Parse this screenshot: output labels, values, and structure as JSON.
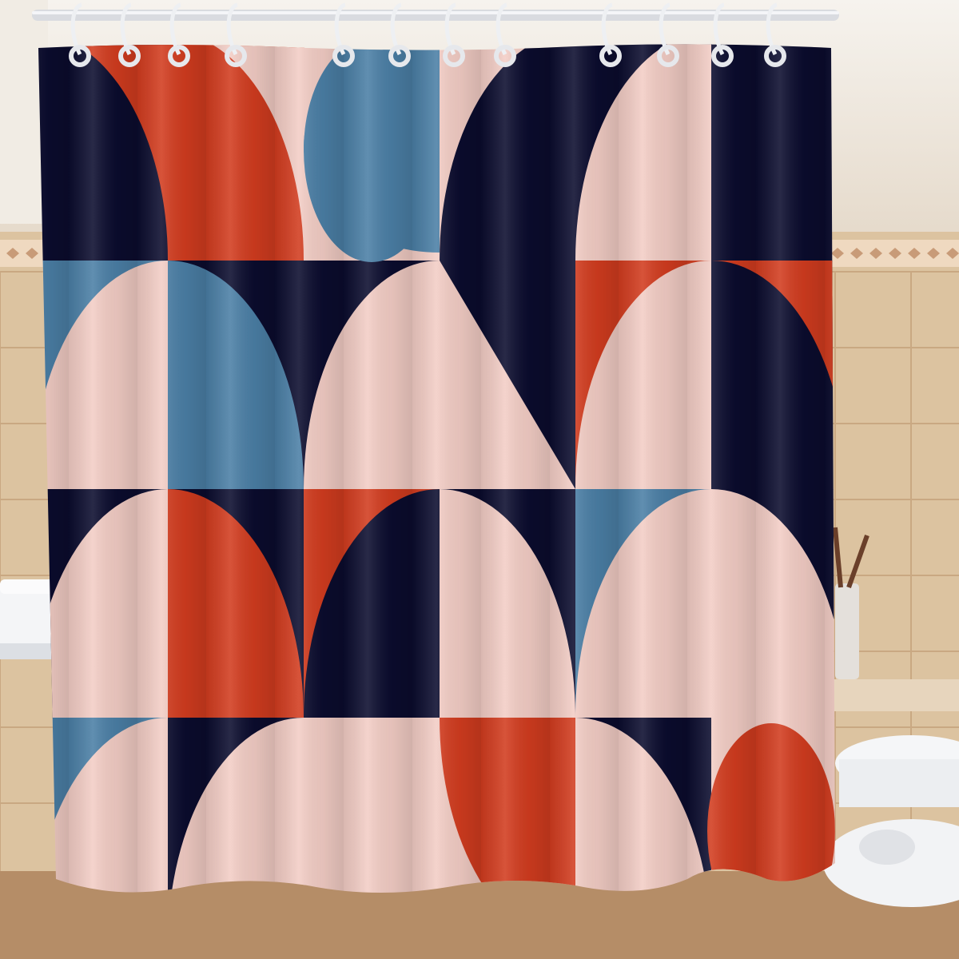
{
  "scene": {
    "subject": "geometric-shower-curtain",
    "hook_count": 12,
    "grid_columns": 6,
    "grid_rows": 4
  },
  "colors": {
    "navy": "#0b0c2e",
    "orange": "#d23c1f",
    "pink": "#f3cdc5",
    "blue": "#4b7fa6",
    "wall_tile": "#dcc3a0",
    "wall_tile_dark": "#c9a882",
    "border_tile": "#efd9c0",
    "bathtub": "#f4f5f7",
    "toilet": "#f5f6f8",
    "rod": "#d9dbe0",
    "floor": "#b58d67"
  },
  "curtain_pattern": [
    [
      {
        "bg": "navy",
        "fg": "orange",
        "shape": "quarter-tr"
      },
      {
        "bg": "orange",
        "fg": "pink",
        "shape": "quarter-tr"
      },
      {
        "bg": "pink",
        "fg": "blue",
        "shape": "oval-half-l"
      },
      {
        "bg": "pink",
        "fg": "navy",
        "shape": "quarter-br"
      },
      {
        "bg": "navy",
        "fg": "pink",
        "shape": "quarter-br"
      },
      {
        "bg": "navy",
        "fg": "navy",
        "shape": "none"
      }
    ],
    [
      {
        "bg": "pink",
        "fg": "blue",
        "shape": "quarter-tl"
      },
      {
        "bg": "navy",
        "fg": "blue",
        "shape": "quarter-bl"
      },
      {
        "bg": "pink",
        "fg": "navy",
        "shape": "quarter-tl"
      },
      {
        "bg": "pink",
        "fg": "navy",
        "shape": "quarter-bl-full"
      },
      {
        "bg": "pink",
        "fg": "orange",
        "shape": "quarter-tl"
      },
      {
        "bg": "navy",
        "fg": "orange",
        "shape": "quarter-tr"
      }
    ],
    [
      {
        "bg": "navy",
        "fg": "pink",
        "shape": "quarter-br"
      },
      {
        "bg": "navy",
        "fg": "orange",
        "shape": "quarter-bl"
      },
      {
        "bg": "navy",
        "fg": "orange",
        "shape": "quarter-tl"
      },
      {
        "bg": "pink",
        "fg": "navy",
        "shape": "quarter-tr"
      },
      {
        "bg": "pink",
        "fg": "blue",
        "shape": "quarter-tl"
      },
      {
        "bg": "pink",
        "fg": "navy",
        "shape": "quarter-tr"
      }
    ],
    [
      {
        "bg": "pink",
        "fg": "blue",
        "shape": "quarter-tl"
      },
      {
        "bg": "pink",
        "fg": "navy",
        "shape": "quarter-tl"
      },
      {
        "bg": "pink",
        "fg": "pink",
        "shape": "none"
      },
      {
        "bg": "pink",
        "fg": "orange",
        "shape": "quarter-br-full"
      },
      {
        "bg": "pink",
        "fg": "navy",
        "shape": "quarter-tr"
      },
      {
        "bg": "pink",
        "fg": "orange",
        "shape": "oval-half-b"
      }
    ]
  ]
}
